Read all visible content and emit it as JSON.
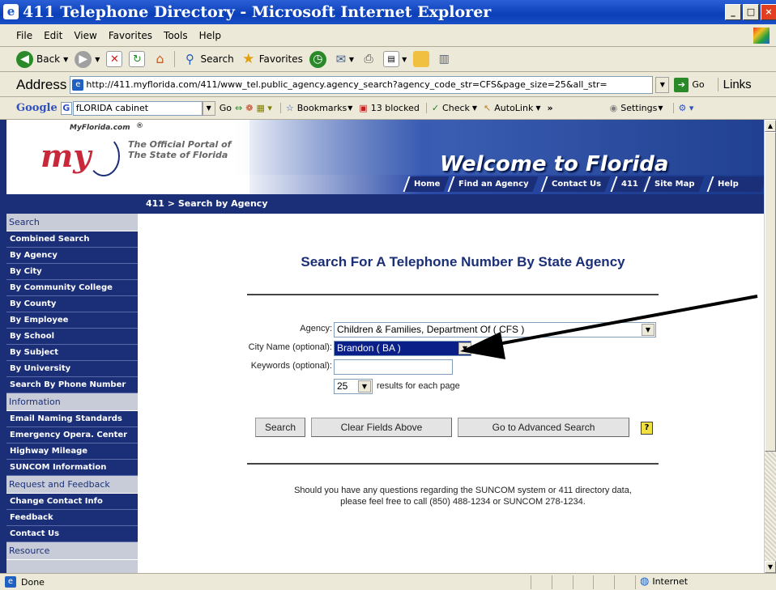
{
  "window": {
    "title": "411 Telephone Directory - Microsoft Internet Explorer"
  },
  "menu": [
    "File",
    "Edit",
    "View",
    "Favorites",
    "Tools",
    "Help"
  ],
  "toolbar": {
    "back": "Back",
    "search": "Search",
    "favorites": "Favorites"
  },
  "address": {
    "label": "Address",
    "url": "http://411.myflorida.com/411/www_tel.public_agency.agency_search?agency_code_str=CFS&page_size=25&all_str=",
    "go": "Go",
    "links": "Links"
  },
  "googlebar": {
    "logo": "Google",
    "query": "fLORIDA cabinet",
    "go": "Go",
    "bookmarks": "Bookmarks",
    "blocked": "13 blocked",
    "check": "Check",
    "autolink": "AutoLink",
    "settings": "Settings"
  },
  "site": {
    "mflcom": "MyFlorida.com",
    "logo": "my",
    "portal_line1": "The Official Portal of",
    "portal_line2": "The State of Florida",
    "welcome": "Welcome to Florida",
    "nav": [
      "Home",
      "Find an Agency",
      "Contact Us",
      "411",
      "Site Map",
      "Help"
    ],
    "breadcrumb": "411 > Search by Agency"
  },
  "sidebar": {
    "search_head": "Search",
    "search_items": [
      "Combined Search",
      "By Agency",
      "By City",
      "By Community College",
      "By County",
      "By Employee",
      "By School",
      "By Subject",
      "By University",
      "Search By Phone Number"
    ],
    "info_head": "Information",
    "info_items": [
      "Email Naming Standards",
      "Emergency Opera. Center",
      "Highway Mileage",
      "SUNCOM Information"
    ],
    "request_head": "Request and Feedback",
    "request_items": [
      "Change Contact Info",
      "Feedback",
      "Contact Us"
    ],
    "resource_head": "Resource"
  },
  "form": {
    "heading": "Search For A Telephone Number By State Agency",
    "agency_label": "Agency:",
    "agency_value": "Children & Families, Department Of ( CFS )",
    "city_label": "City Name (optional):",
    "city_value": "Brandon ( BA )",
    "keywords_label": "Keywords (optional):",
    "keywords_value": "",
    "page_size": "25",
    "page_size_suffix": "results for each page",
    "search_btn": "Search",
    "clear_btn": "Clear Fields Above",
    "advanced_btn": "Go to Advanced Search",
    "info_line1": "Should you have any questions regarding the SUNCOM system or 411 directory data,",
    "info_line2": "please feel free to call (850) 488-1234 or SUNCOM 278-1234."
  },
  "status": {
    "text": "Done",
    "zone": "Internet"
  }
}
